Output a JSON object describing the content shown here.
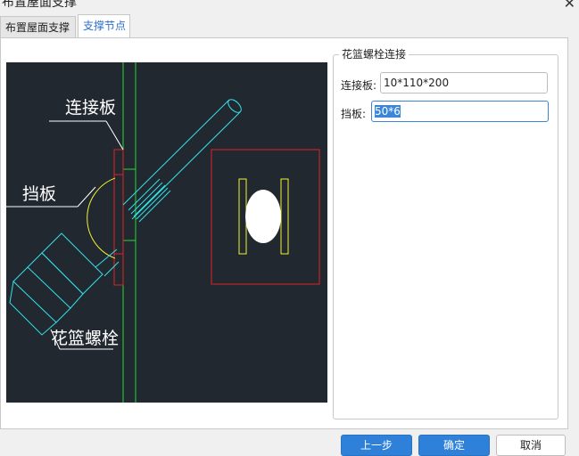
{
  "window": {
    "title": "布置屋面支撑",
    "close_glyph": "✕"
  },
  "tabs": [
    {
      "label": "布置屋面支撑",
      "active": false
    },
    {
      "label": "支撑节点",
      "active": true
    }
  ],
  "drawing": {
    "labels": {
      "connector_plate": "连接板",
      "baffle": "挡板",
      "turnbuckle_bolt": "花篮螺栓"
    },
    "colors": {
      "background": "#212830",
      "green": "#22dd33",
      "red": "#e02424",
      "cyan": "#33e0e8",
      "yellow": "#f2f233",
      "white": "#ffffff"
    }
  },
  "form": {
    "group_title": "花篮螺栓连接",
    "fields": [
      {
        "label": "连接板:",
        "value": "10*110*200"
      },
      {
        "label": "挡板:",
        "value": "50*6"
      }
    ]
  },
  "buttons": {
    "prev": "上一步",
    "ok": "确定",
    "cancel": "取消"
  },
  "colors": {
    "accent": "#2f80d8",
    "tab_active_text": "#2a6fc9"
  }
}
